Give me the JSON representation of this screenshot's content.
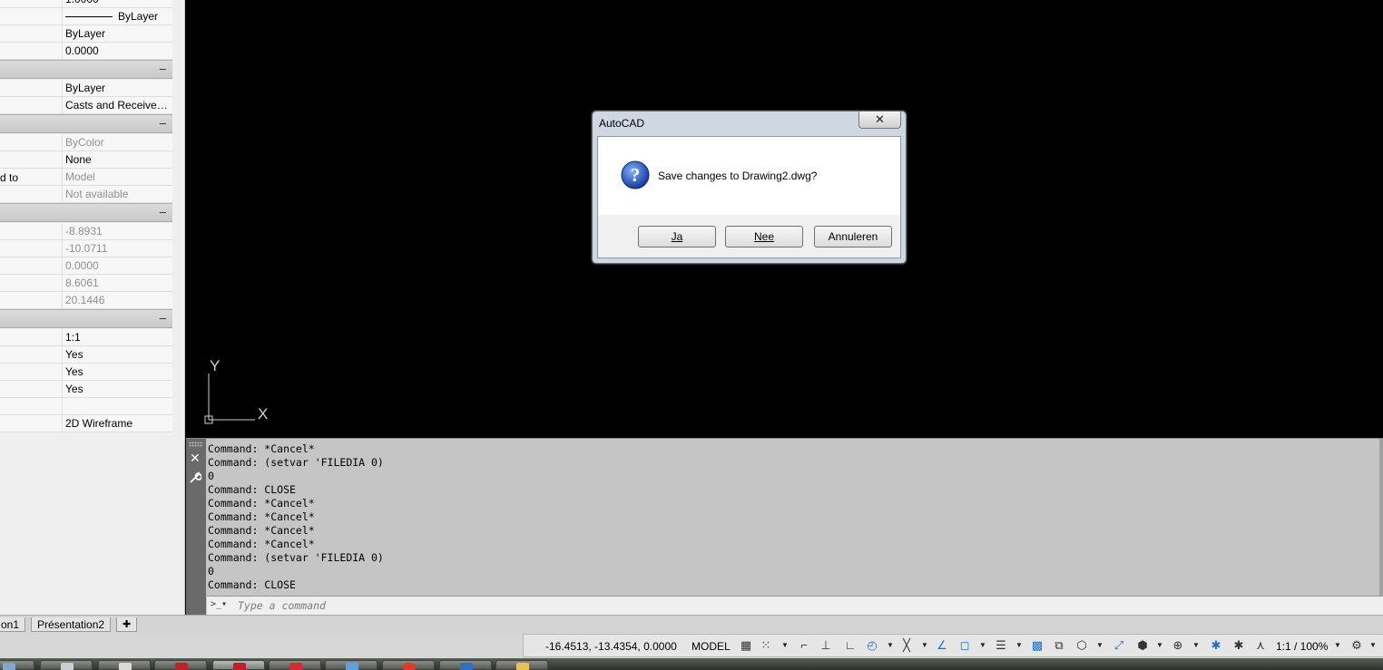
{
  "properties": {
    "rows_group1": [
      {
        "value": "1.0000",
        "readonly": false
      },
      {
        "value": "ByLayer",
        "readonly": false,
        "line": true
      },
      {
        "value": "ByLayer",
        "readonly": false
      },
      {
        "value": "0.0000",
        "readonly": false
      }
    ],
    "rows_group2": [
      {
        "value": "ByLayer",
        "readonly": false
      },
      {
        "value": "Casts  and  Receives…",
        "readonly": false
      }
    ],
    "rows_group3": [
      {
        "name": "",
        "value": "ByColor",
        "readonly": true
      },
      {
        "name": "",
        "value": "None",
        "readonly": false
      },
      {
        "name": "d to",
        "value": "Model",
        "readonly": true
      },
      {
        "name": "",
        "value": "Not available",
        "readonly": true
      }
    ],
    "rows_group4": [
      {
        "value": "-8.8931"
      },
      {
        "value": "-10.0711"
      },
      {
        "value": "0.0000"
      },
      {
        "value": "8.6061"
      },
      {
        "value": "20.1446"
      }
    ],
    "rows_group5": [
      {
        "value": "1:1"
      },
      {
        "value": "Yes"
      },
      {
        "value": "Yes"
      },
      {
        "value": "Yes"
      },
      {
        "value": ""
      },
      {
        "value": "2D Wireframe"
      }
    ],
    "collapse_glyph": "–"
  },
  "ucs": {
    "y_label": "Y",
    "x_label": "X"
  },
  "dialog": {
    "title": "AutoCAD",
    "close_glyph": "✕",
    "message": "Save changes to Drawing2.dwg?",
    "buttons": {
      "yes": "Ja",
      "no": "Nee",
      "cancel": "Annuleren"
    }
  },
  "command": {
    "history": [
      "Command: *Cancel*",
      "Command: (setvar 'FILEDIA 0)",
      "0",
      "Command: CLOSE",
      "Command: *Cancel*",
      "Command: *Cancel*",
      "Command: *Cancel*",
      "Command: *Cancel*",
      "Command: (setvar 'FILEDIA 0)",
      "0",
      "Command: CLOSE"
    ],
    "placeholder": "Type a command",
    "prompt_glyph": ">_▾",
    "close_glyph": "✕",
    "settings_glyph": "🔧"
  },
  "layout_tabs": {
    "tab1": "on1",
    "tab2": "Présentation2",
    "add_glyph": "✚"
  },
  "status": {
    "coords": "-16.4513, -13.4354, 0.0000",
    "model": "MODEL",
    "scale": "1:1 / 100%"
  },
  "colors": {
    "canvas": "#000000",
    "accent": "#1d6fcf",
    "dialog_frame": "#cfd7e2"
  }
}
